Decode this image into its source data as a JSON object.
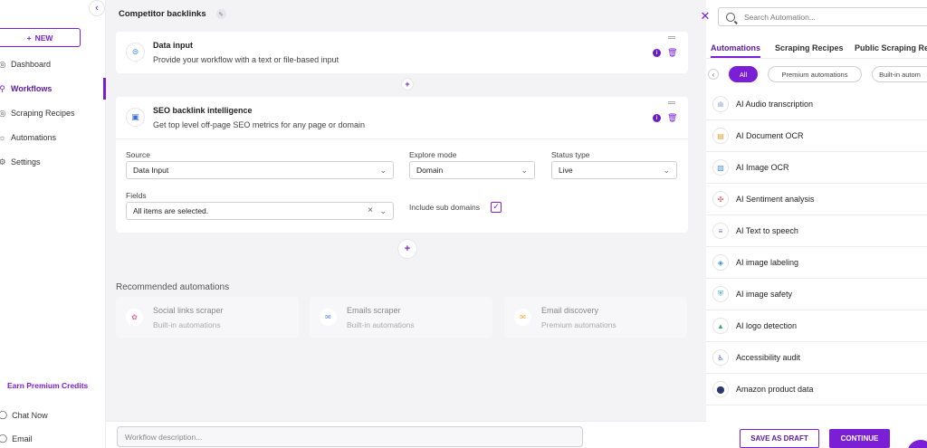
{
  "sidebar": {
    "new_label": "NEW",
    "nav": [
      {
        "label": "Dashboard",
        "icon": "dashboard-icon"
      },
      {
        "label": "Workflows",
        "icon": "workflow-icon"
      },
      {
        "label": "Scraping Recipes",
        "icon": "recipe-icon"
      },
      {
        "label": "Automations",
        "icon": "bulb-icon"
      },
      {
        "label": "Settings",
        "icon": "gear-icon"
      }
    ],
    "active": "Workflows",
    "earn": "Earn Premium Credits",
    "chat": "Chat Now",
    "email": "Email"
  },
  "workflow": {
    "title": "Competitor backlinks",
    "steps": [
      {
        "title": "Data input",
        "subtitle": "Provide your workflow with a text or file-based input"
      },
      {
        "title": "SEO backlink intelligence",
        "subtitle": "Get top level off-page SEO metrics for any page or domain"
      }
    ],
    "form": {
      "source_label": "Source",
      "source_value": "Data Input",
      "explore_label": "Explore mode",
      "explore_value": "Domain",
      "status_label": "Status type",
      "status_value": "Live",
      "fields_label": "Fields",
      "fields_value": "All items are selected.",
      "subdomains_label": "Include sub domains",
      "subdomains_checked": true
    },
    "recommended_title": "Recommended automations",
    "recommended": [
      {
        "title": "Social links scraper",
        "subtitle": "Built-in automations"
      },
      {
        "title": "Emails scraper",
        "subtitle": "Built-in automations"
      },
      {
        "title": "Email discovery",
        "subtitle": "Premium automations"
      }
    ],
    "description_placeholder": "Workflow description..."
  },
  "panel": {
    "search_placeholder": "Search Automation...",
    "tabs": [
      "Automations",
      "Scraping Recipes",
      "Public Scraping Re"
    ],
    "active_tab": "Automations",
    "chips": [
      "All",
      "Premium automations",
      "Built-in autom"
    ],
    "active_chip": "All",
    "items": [
      "AI Audio transcription",
      "AI Document OCR",
      "AI Image OCR",
      "AI Sentiment analysis",
      "AI Text to speech",
      "AI image labeling",
      "AI image safety",
      "AI logo detection",
      "Accessibility audit",
      "Amazon product data"
    ],
    "save_draft": "SAVE AS DRAFT",
    "continue": "CONTINUE"
  },
  "colors": {
    "accent": "#7a1fd6",
    "accent_dark": "#5b1aa6",
    "bg": "#f3f3f5"
  }
}
